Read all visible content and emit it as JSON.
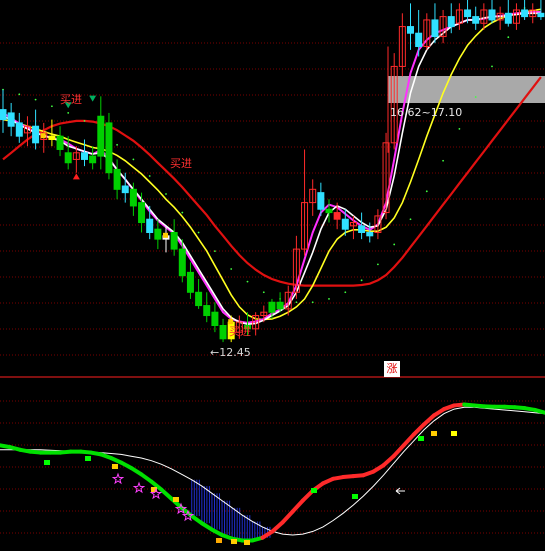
{
  "chart_data": {
    "type": "candlestick",
    "price_panel": {
      "marker_down_color": "#00b060",
      "marker_up_color": "#ff2020",
      "annotations": {
        "low_label": "←12.45",
        "range_label": "16.62~17.10",
        "zhang_badge": "涨",
        "buy_labels": [
          "买进",
          "买进",
          "买进"
        ]
      },
      "candles": [
        {
          "o": 15.95,
          "h": 16.25,
          "l": 15.6,
          "c": 15.8,
          "color": "cyan"
        },
        {
          "o": 15.9,
          "h": 16.05,
          "l": 15.55,
          "c": 15.7,
          "color": "cyan"
        },
        {
          "o": 15.75,
          "h": 15.9,
          "l": 15.45,
          "c": 15.55,
          "color": "cyan"
        },
        {
          "o": 15.6,
          "h": 15.85,
          "l": 15.4,
          "c": 15.7,
          "color": "red"
        },
        {
          "o": 15.7,
          "h": 15.95,
          "l": 15.35,
          "c": 15.45,
          "color": "cyan"
        },
        {
          "o": 15.5,
          "h": 15.75,
          "l": 15.3,
          "c": 15.6,
          "color": "red"
        },
        {
          "o": 15.55,
          "h": 15.8,
          "l": 15.4,
          "c": 15.5,
          "color": "yellow"
        },
        {
          "o": 15.55,
          "h": 15.7,
          "l": 15.25,
          "c": 15.35,
          "color": "green"
        },
        {
          "o": 15.3,
          "h": 15.55,
          "l": 15.05,
          "c": 15.15,
          "color": "green"
        },
        {
          "o": 15.2,
          "h": 15.4,
          "l": 15.0,
          "c": 15.3,
          "color": "red"
        },
        {
          "o": 15.3,
          "h": 15.5,
          "l": 15.1,
          "c": 15.2,
          "color": "cyan"
        },
        {
          "o": 15.25,
          "h": 15.4,
          "l": 15.05,
          "c": 15.15,
          "color": "green"
        },
        {
          "o": 15.25,
          "h": 16.15,
          "l": 15.05,
          "c": 15.85,
          "color": "green"
        },
        {
          "o": 15.75,
          "h": 15.9,
          "l": 14.9,
          "c": 15.0,
          "color": "green"
        },
        {
          "o": 15.05,
          "h": 15.2,
          "l": 14.6,
          "c": 14.75,
          "color": "green"
        },
        {
          "o": 14.8,
          "h": 15.0,
          "l": 14.55,
          "c": 14.7,
          "color": "cyan"
        },
        {
          "o": 14.75,
          "h": 14.85,
          "l": 14.35,
          "c": 14.5,
          "color": "green"
        },
        {
          "o": 14.55,
          "h": 14.7,
          "l": 14.1,
          "c": 14.25,
          "color": "green"
        },
        {
          "o": 14.3,
          "h": 14.5,
          "l": 14.0,
          "c": 14.1,
          "color": "cyan"
        },
        {
          "o": 14.15,
          "h": 14.3,
          "l": 13.85,
          "c": 14.0,
          "color": "green"
        },
        {
          "o": 14.0,
          "h": 14.2,
          "l": 13.8,
          "c": 14.05,
          "color": "white"
        },
        {
          "o": 14.1,
          "h": 14.3,
          "l": 13.75,
          "c": 13.85,
          "color": "green"
        },
        {
          "o": 13.85,
          "h": 14.0,
          "l": 13.35,
          "c": 13.45,
          "color": "green"
        },
        {
          "o": 13.5,
          "h": 13.65,
          "l": 13.1,
          "c": 13.2,
          "color": "green"
        },
        {
          "o": 13.2,
          "h": 13.4,
          "l": 12.95,
          "c": 13.0,
          "color": "green"
        },
        {
          "o": 13.0,
          "h": 13.2,
          "l": 12.75,
          "c": 12.85,
          "color": "green"
        },
        {
          "o": 12.9,
          "h": 13.05,
          "l": 12.6,
          "c": 12.7,
          "color": "green"
        },
        {
          "o": 12.7,
          "h": 12.8,
          "l": 12.45,
          "c": 12.5,
          "color": "green"
        },
        {
          "o": 12.5,
          "h": 12.85,
          "l": 12.45,
          "c": 12.75,
          "color": "yellow"
        },
        {
          "o": 12.6,
          "h": 12.85,
          "l": 12.5,
          "c": 12.75,
          "color": "red"
        },
        {
          "o": 12.7,
          "h": 12.9,
          "l": 12.55,
          "c": 12.65,
          "color": "green"
        },
        {
          "o": 12.65,
          "h": 12.9,
          "l": 12.55,
          "c": 12.85,
          "color": "red"
        },
        {
          "o": 12.85,
          "h": 13.0,
          "l": 12.75,
          "c": 12.9,
          "color": "red"
        },
        {
          "o": 12.9,
          "h": 13.1,
          "l": 12.8,
          "c": 13.05,
          "color": "green"
        },
        {
          "o": 13.05,
          "h": 13.2,
          "l": 12.9,
          "c": 12.95,
          "color": "green"
        },
        {
          "o": 12.95,
          "h": 13.3,
          "l": 12.85,
          "c": 13.2,
          "color": "red"
        },
        {
          "o": 13.2,
          "h": 14.05,
          "l": 13.1,
          "c": 13.85,
          "color": "red"
        },
        {
          "o": 13.85,
          "h": 15.35,
          "l": 13.75,
          "c": 14.55,
          "color": "red"
        },
        {
          "o": 14.55,
          "h": 14.9,
          "l": 14.35,
          "c": 14.75,
          "color": "red"
        },
        {
          "o": 14.7,
          "h": 14.85,
          "l": 14.35,
          "c": 14.45,
          "color": "cyan"
        },
        {
          "o": 14.45,
          "h": 14.6,
          "l": 14.25,
          "c": 14.4,
          "color": "green"
        },
        {
          "o": 14.4,
          "h": 14.55,
          "l": 14.15,
          "c": 14.3,
          "color": "red"
        },
        {
          "o": 14.3,
          "h": 14.45,
          "l": 14.05,
          "c": 14.15,
          "color": "cyan"
        },
        {
          "o": 14.2,
          "h": 14.35,
          "l": 14.0,
          "c": 14.25,
          "color": "red"
        },
        {
          "o": 14.2,
          "h": 14.4,
          "l": 14.0,
          "c": 14.1,
          "color": "cyan"
        },
        {
          "o": 14.1,
          "h": 14.25,
          "l": 13.95,
          "c": 14.05,
          "color": "cyan"
        },
        {
          "o": 14.1,
          "h": 14.45,
          "l": 14.0,
          "c": 14.35,
          "color": "red"
        },
        {
          "o": 14.4,
          "h": 15.6,
          "l": 14.3,
          "c": 15.45,
          "color": "red"
        },
        {
          "o": 15.45,
          "h": 16.8,
          "l": 15.35,
          "c": 16.6,
          "color": "red"
        },
        {
          "o": 16.6,
          "h": 17.4,
          "l": 16.45,
          "c": 17.2,
          "color": "red"
        },
        {
          "o": 17.2,
          "h": 17.55,
          "l": 16.85,
          "c": 17.1,
          "color": "cyan"
        },
        {
          "o": 17.1,
          "h": 17.45,
          "l": 16.75,
          "c": 16.9,
          "color": "cyan"
        },
        {
          "o": 16.9,
          "h": 17.4,
          "l": 16.85,
          "c": 17.3,
          "color": "red"
        },
        {
          "o": 17.3,
          "h": 17.55,
          "l": 16.95,
          "c": 17.05,
          "color": "cyan"
        },
        {
          "o": 17.05,
          "h": 17.45,
          "l": 16.95,
          "c": 17.35,
          "color": "red"
        },
        {
          "o": 17.35,
          "h": 17.55,
          "l": 17.1,
          "c": 17.2,
          "color": "cyan"
        },
        {
          "o": 17.25,
          "h": 17.55,
          "l": 17.15,
          "c": 17.45,
          "color": "red"
        },
        {
          "o": 17.45,
          "h": 17.6,
          "l": 17.25,
          "c": 17.35,
          "color": "cyan"
        },
        {
          "o": 17.35,
          "h": 17.5,
          "l": 17.15,
          "c": 17.25,
          "color": "cyan"
        },
        {
          "o": 17.25,
          "h": 17.55,
          "l": 17.15,
          "c": 17.45,
          "color": "red"
        },
        {
          "o": 17.45,
          "h": 17.6,
          "l": 17.25,
          "c": 17.3,
          "color": "cyan"
        },
        {
          "o": 17.3,
          "h": 17.5,
          "l": 17.15,
          "c": 17.4,
          "color": "red"
        },
        {
          "o": 17.4,
          "h": 17.6,
          "l": 17.2,
          "c": 17.25,
          "color": "cyan"
        },
        {
          "o": 17.25,
          "h": 17.55,
          "l": 17.15,
          "c": 17.45,
          "color": "red"
        },
        {
          "o": 17.45,
          "h": 17.6,
          "l": 17.3,
          "c": 17.35,
          "color": "cyan"
        },
        {
          "o": 17.35,
          "h": 17.55,
          "l": 17.25,
          "c": 17.45,
          "color": "red"
        },
        {
          "o": 17.4,
          "h": 17.6,
          "l": 17.3,
          "c": 17.35,
          "color": "cyan"
        }
      ],
      "lines": {
        "white": [
          15.85,
          15.8,
          15.72,
          15.66,
          15.6,
          15.56,
          15.52,
          15.48,
          15.4,
          15.36,
          15.32,
          15.28,
          15.3,
          15.2,
          15.05,
          14.9,
          14.75,
          14.6,
          14.45,
          14.3,
          14.2,
          14.1,
          13.95,
          13.75,
          13.55,
          13.35,
          13.15,
          12.95,
          12.82,
          12.75,
          12.72,
          12.73,
          12.78,
          12.85,
          12.92,
          13.0,
          13.2,
          13.5,
          13.8,
          14.15,
          14.4,
          14.5,
          14.45,
          14.35,
          14.25,
          14.18,
          14.2,
          14.45,
          14.95,
          15.6,
          16.2,
          16.6,
          16.85,
          17.0,
          17.1,
          17.2,
          17.25,
          17.3,
          17.3,
          17.33,
          17.35,
          17.35,
          17.37,
          17.38,
          17.4,
          17.4,
          17.4
        ],
        "yellow": [
          15.8,
          15.78,
          15.74,
          15.7,
          15.66,
          15.62,
          15.58,
          15.55,
          15.5,
          15.46,
          15.42,
          15.38,
          15.36,
          15.32,
          15.26,
          15.18,
          15.08,
          14.98,
          14.86,
          14.74,
          14.6,
          14.48,
          14.34,
          14.18,
          14.0,
          13.82,
          13.6,
          13.38,
          13.16,
          12.98,
          12.86,
          12.8,
          12.79,
          12.8,
          12.84,
          12.9,
          12.98,
          13.1,
          13.3,
          13.56,
          13.82,
          14.0,
          14.1,
          14.14,
          14.14,
          14.12,
          14.12,
          14.18,
          14.32,
          14.55,
          14.86,
          15.2,
          15.55,
          15.88,
          16.2,
          16.48,
          16.72,
          16.92,
          17.06,
          17.18,
          17.26,
          17.32,
          17.36,
          17.4,
          17.42,
          17.44,
          17.46
        ],
        "magenta": [
          15.9,
          15.82,
          15.74,
          15.68,
          15.6,
          15.56,
          15.52,
          15.5,
          15.44,
          15.36,
          15.32,
          15.28,
          15.34,
          15.22,
          15.04,
          14.9,
          14.74,
          14.58,
          14.42,
          14.28,
          14.18,
          14.08,
          13.9,
          13.7,
          13.5,
          13.3,
          13.1,
          12.9,
          12.8,
          12.76,
          12.74,
          12.76,
          12.8,
          12.88,
          12.94,
          13.04,
          13.3,
          13.7,
          14.1,
          14.4,
          14.52,
          14.48,
          14.38,
          14.28,
          14.2,
          14.14,
          14.22,
          14.55,
          15.2,
          15.9,
          16.5,
          16.85,
          17.0,
          17.1,
          17.15,
          17.2,
          17.25,
          17.3,
          17.3,
          17.32,
          17.35,
          17.36,
          17.38,
          17.4,
          17.4,
          17.42,
          17.42
        ],
        "red": [
          15.2,
          15.3,
          15.4,
          15.5,
          15.58,
          15.64,
          15.7,
          15.74,
          15.76,
          15.78,
          15.78,
          15.77,
          15.74,
          15.7,
          15.64,
          15.56,
          15.48,
          15.38,
          15.27,
          15.15,
          15.03,
          14.91,
          14.78,
          14.64,
          14.5,
          14.36,
          14.2,
          14.05,
          13.9,
          13.76,
          13.64,
          13.54,
          13.46,
          13.4,
          13.36,
          13.33,
          13.31,
          13.3,
          13.3,
          13.3,
          13.3,
          13.3,
          13.3,
          13.3,
          13.31,
          13.33,
          13.38,
          13.46,
          13.58,
          13.72,
          13.88,
          14.04,
          14.2,
          14.36,
          14.52,
          14.68,
          14.84,
          15.0,
          15.16,
          15.32,
          15.48,
          15.64,
          15.8,
          15.96,
          16.12,
          16.28,
          16.44
        ],
        "green_dots": [
          16.25,
          16.22,
          16.18,
          16.14,
          16.1,
          16.05,
          16.0,
          15.95,
          15.9,
          15.85,
          15.78,
          15.7,
          15.62,
          15.52,
          15.42,
          15.32,
          15.2,
          15.08,
          14.95,
          14.82,
          14.68,
          14.54,
          14.4,
          14.26,
          14.1,
          13.96,
          13.82,
          13.68,
          13.55,
          13.45,
          13.36,
          13.28,
          13.2,
          13.14,
          13.1,
          13.07,
          13.05,
          13.04,
          13.05,
          13.07,
          13.1,
          13.14,
          13.2,
          13.28,
          13.38,
          13.5,
          13.62,
          13.76,
          13.92,
          14.1,
          14.3,
          14.5,
          14.72,
          14.95,
          15.18,
          15.42,
          15.66,
          15.9,
          16.14,
          16.38,
          16.6,
          16.82,
          17.04,
          17.26,
          17.48,
          17.7,
          17.9
        ]
      }
    },
    "indicator_panel": {
      "type": "line",
      "main_line_colors": {
        "down": "#00e000",
        "up": "#ff2a2a"
      },
      "main": [
        1.0,
        0.96,
        0.9,
        0.86,
        0.84,
        0.84,
        0.84,
        0.86,
        0.86,
        0.84,
        0.8,
        0.72,
        0.62,
        0.5,
        0.36,
        0.2,
        0.02,
        -0.18,
        -0.38,
        -0.56,
        -0.72,
        -0.86,
        -0.98,
        -1.06,
        -1.1,
        -1.1,
        -1.04,
        -0.9,
        -0.7,
        -0.46,
        -0.22,
        0.0,
        0.16,
        0.26,
        0.3,
        0.32,
        0.34,
        0.42,
        0.56,
        0.76,
        1.0,
        1.24,
        1.46,
        1.66,
        1.8,
        1.88,
        1.9,
        1.88,
        1.86,
        1.85,
        1.85,
        1.84,
        1.82,
        1.78,
        1.72
      ],
      "signal": [
        0.9,
        0.9,
        0.9,
        0.9,
        0.9,
        0.89,
        0.88,
        0.87,
        0.86,
        0.85,
        0.84,
        0.82,
        0.8,
        0.76,
        0.72,
        0.66,
        0.58,
        0.48,
        0.36,
        0.24,
        0.1,
        -0.06,
        -0.22,
        -0.38,
        -0.54,
        -0.68,
        -0.8,
        -0.9,
        -0.96,
        -0.98,
        -0.96,
        -0.9,
        -0.8,
        -0.66,
        -0.5,
        -0.32,
        -0.12,
        0.1,
        0.34,
        0.6,
        0.86,
        1.1,
        1.34,
        1.54,
        1.7,
        1.8,
        1.84,
        1.84,
        1.82,
        1.8,
        1.78,
        1.76,
        1.74,
        1.72,
        1.7
      ],
      "markers": [
        "square-green",
        "square-yellow",
        "star-magenta",
        "square-orange",
        "arrow-white"
      ]
    }
  }
}
